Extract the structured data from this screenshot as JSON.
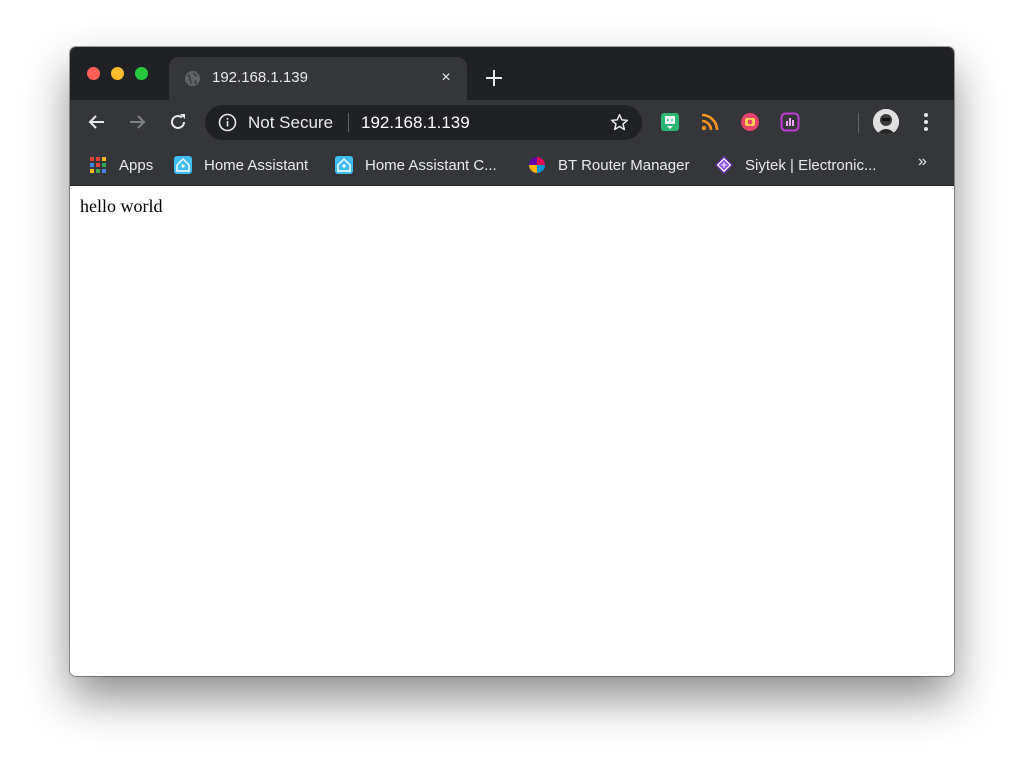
{
  "window": {
    "traffic_lights": [
      "close",
      "minimize",
      "zoom"
    ]
  },
  "tab": {
    "favicon": "globe-icon",
    "title": "192.168.1.139",
    "close_label": "×",
    "new_tab_icon": "plus-icon"
  },
  "toolbar": {
    "back_icon": "arrow-left-icon",
    "forward_icon": "arrow-right-icon",
    "reload_icon": "reload-icon",
    "security_label": "Not Secure",
    "url": "192.168.1.139",
    "bookmark_icon": "star-icon",
    "extensions": [
      "green-face-extension-icon",
      "rss-icon",
      "orange-camera-extension-icon",
      "purple-chart-extension-icon"
    ],
    "menu_icon": "kebab-menu-icon"
  },
  "bookmarks": {
    "items": [
      {
        "label": "Apps",
        "icon": "apps-grid-icon"
      },
      {
        "label": "Home Assistant",
        "icon": "home-assistant-icon"
      },
      {
        "label": "Home Assistant C...",
        "icon": "home-assistant-icon"
      },
      {
        "label": "BT Router Manager",
        "icon": "bt-globe-icon"
      },
      {
        "label": "Siytek | Electronic...",
        "icon": "siytek-diamond-icon"
      }
    ],
    "overflow_label": "»"
  },
  "page": {
    "text": "hello world"
  },
  "colors": {
    "tabstrip_bg": "#202124",
    "toolbar_bg": "#35363a",
    "text": "#e8eaed"
  }
}
